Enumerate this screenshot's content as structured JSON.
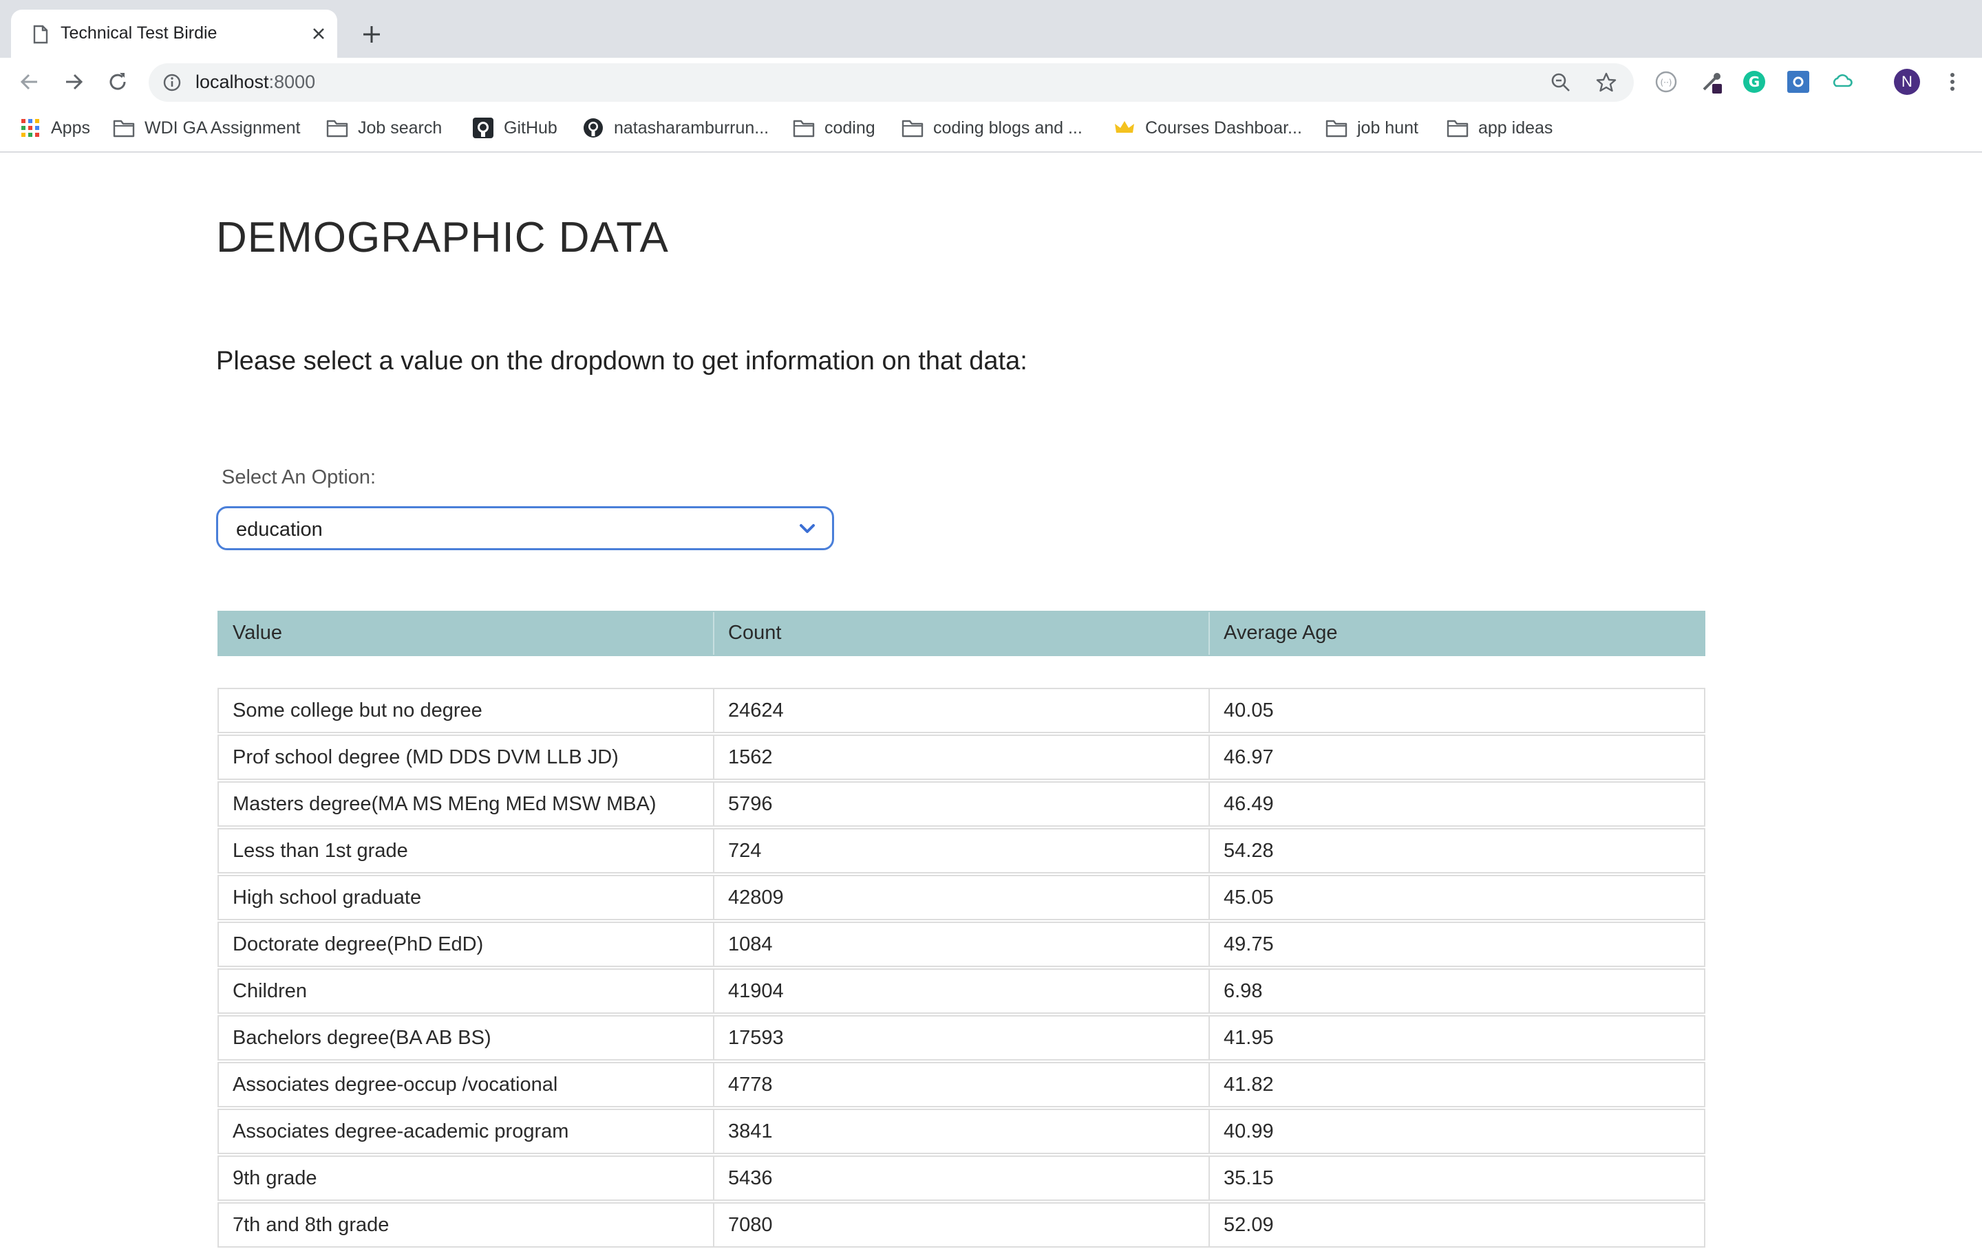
{
  "browser": {
    "tab_title": "Technical Test Birdie",
    "url_host": "localhost",
    "url_port": ":8000",
    "profile_initial": "N",
    "bookmarks": [
      {
        "label": "Apps",
        "icon": "apps-grid-icon"
      },
      {
        "label": "WDI GA Assignment",
        "icon": "folder-icon"
      },
      {
        "label": "Job search",
        "icon": "folder-icon"
      },
      {
        "label": "GitHub",
        "icon": "github-icon"
      },
      {
        "label": "natasharamburrun...",
        "icon": "github-icon"
      },
      {
        "label": "coding",
        "icon": "folder-icon"
      },
      {
        "label": "coding blogs and ...",
        "icon": "folder-icon"
      },
      {
        "label": "Courses Dashboar...",
        "icon": "crown-icon"
      },
      {
        "label": "job hunt",
        "icon": "folder-icon"
      },
      {
        "label": "app ideas",
        "icon": "folder-icon"
      }
    ]
  },
  "page": {
    "title": "DEMOGRAPHIC DATA",
    "prompt": "Please select a value on the dropdown to get information on that data:",
    "select_label": "Select An Option:",
    "select_value": "education",
    "accent_color": "#4a7fd9",
    "header_color": "#a4cacc"
  },
  "table": {
    "headers": [
      "Value",
      "Count",
      "Average Age"
    ],
    "rows": [
      [
        "Some college but no degree",
        "24624",
        "40.05"
      ],
      [
        "Prof school degree (MD DDS DVM LLB JD)",
        "1562",
        "46.97"
      ],
      [
        "Masters degree(MA MS MEng MEd MSW MBA)",
        "5796",
        "46.49"
      ],
      [
        "Less than 1st grade",
        "724",
        "54.28"
      ],
      [
        "High school graduate",
        "42809",
        "45.05"
      ],
      [
        "Doctorate degree(PhD EdD)",
        "1084",
        "49.75"
      ],
      [
        "Children",
        "41904",
        "6.98"
      ],
      [
        "Bachelors degree(BA AB BS)",
        "17593",
        "41.95"
      ],
      [
        "Associates degree-occup /vocational",
        "4778",
        "41.82"
      ],
      [
        "Associates degree-academic program",
        "3841",
        "40.99"
      ],
      [
        "9th grade",
        "5436",
        "35.15"
      ],
      [
        "7th and 8th grade",
        "7080",
        "52.09"
      ]
    ]
  }
}
